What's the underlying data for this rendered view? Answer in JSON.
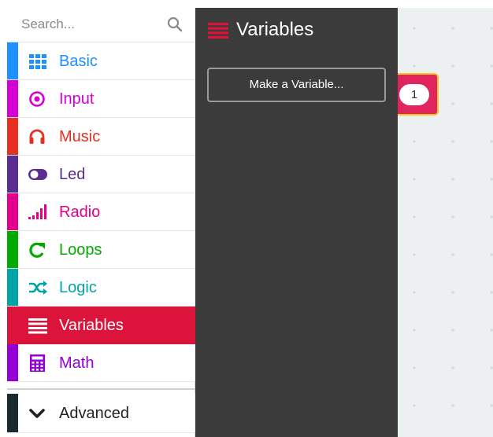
{
  "search": {
    "placeholder": "Search..."
  },
  "toolbox": {
    "categories": [
      {
        "id": "basic",
        "label": "Basic",
        "color": "#1e90ff",
        "icon": "grid-icon"
      },
      {
        "id": "input",
        "label": "Input",
        "color": "#d400d4",
        "icon": "target-icon"
      },
      {
        "id": "music",
        "label": "Music",
        "color": "#e63022",
        "icon": "headphones-icon"
      },
      {
        "id": "led",
        "label": "Led",
        "color": "#5c2d91",
        "icon": "toggle-icon"
      },
      {
        "id": "radio",
        "label": "Radio",
        "color": "#e3008c",
        "icon": "signal-bars-icon"
      },
      {
        "id": "loops",
        "label": "Loops",
        "color": "#00aa00",
        "icon": "refresh-icon"
      },
      {
        "id": "logic",
        "label": "Logic",
        "color": "#00a4a6",
        "icon": "shuffle-icon"
      },
      {
        "id": "variables",
        "label": "Variables",
        "color": "#dc143c",
        "icon": "lines-icon",
        "selected": true
      },
      {
        "id": "math",
        "label": "Math",
        "color": "#9400d3",
        "icon": "calculator-icon"
      }
    ],
    "advanced": {
      "label": "Advanced",
      "color": "#1a2b30",
      "icon": "chevron-down-icon"
    }
  },
  "flyout": {
    "title": "Variables",
    "title_color": "#dc143c",
    "make_button": "Make a Variable..."
  },
  "workspace": {
    "block": {
      "value": "1",
      "color": "#e0245e",
      "outline": "#f5c518"
    }
  }
}
